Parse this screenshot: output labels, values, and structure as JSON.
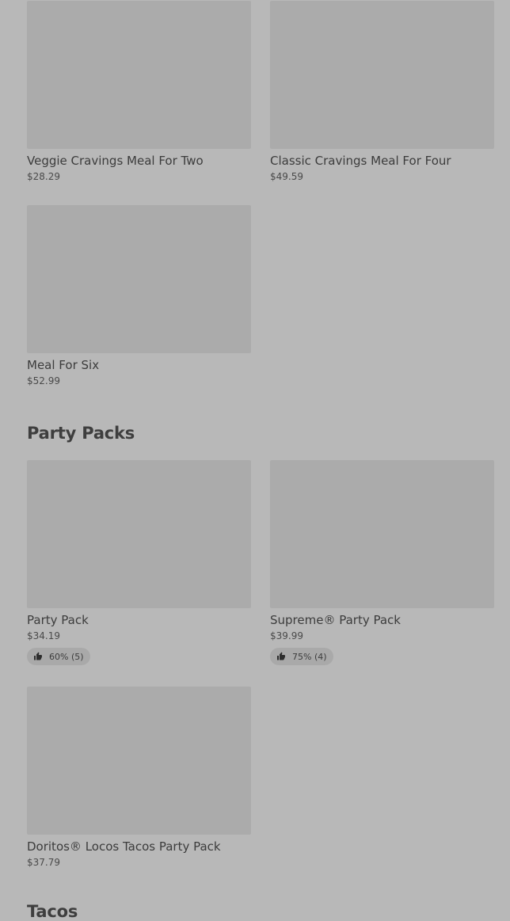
{
  "meals": {
    "items": [
      {
        "title": "Veggie Cravings Meal For Two",
        "price": "$28.29"
      },
      {
        "title": "Classic Cravings Meal For Four",
        "price": "$49.59"
      },
      {
        "title": "Meal For Six",
        "price": "$52.99"
      }
    ]
  },
  "party_packs": {
    "heading": "Party Packs",
    "items": [
      {
        "title": "Party Pack",
        "price": "$34.19",
        "rating": "60% (5)"
      },
      {
        "title": "Supreme® Party Pack",
        "price": "$39.99",
        "rating": "75% (4)"
      },
      {
        "title": "Doritos® Locos Tacos Party Pack",
        "price": "$37.79"
      }
    ]
  },
  "tacos": {
    "heading": "Tacos"
  },
  "icons": {
    "rating": "thumbs-up-icon"
  },
  "colors": {
    "background": "#b8b8b8",
    "image_placeholder": "#ababab",
    "text": "#3c3c3c"
  }
}
